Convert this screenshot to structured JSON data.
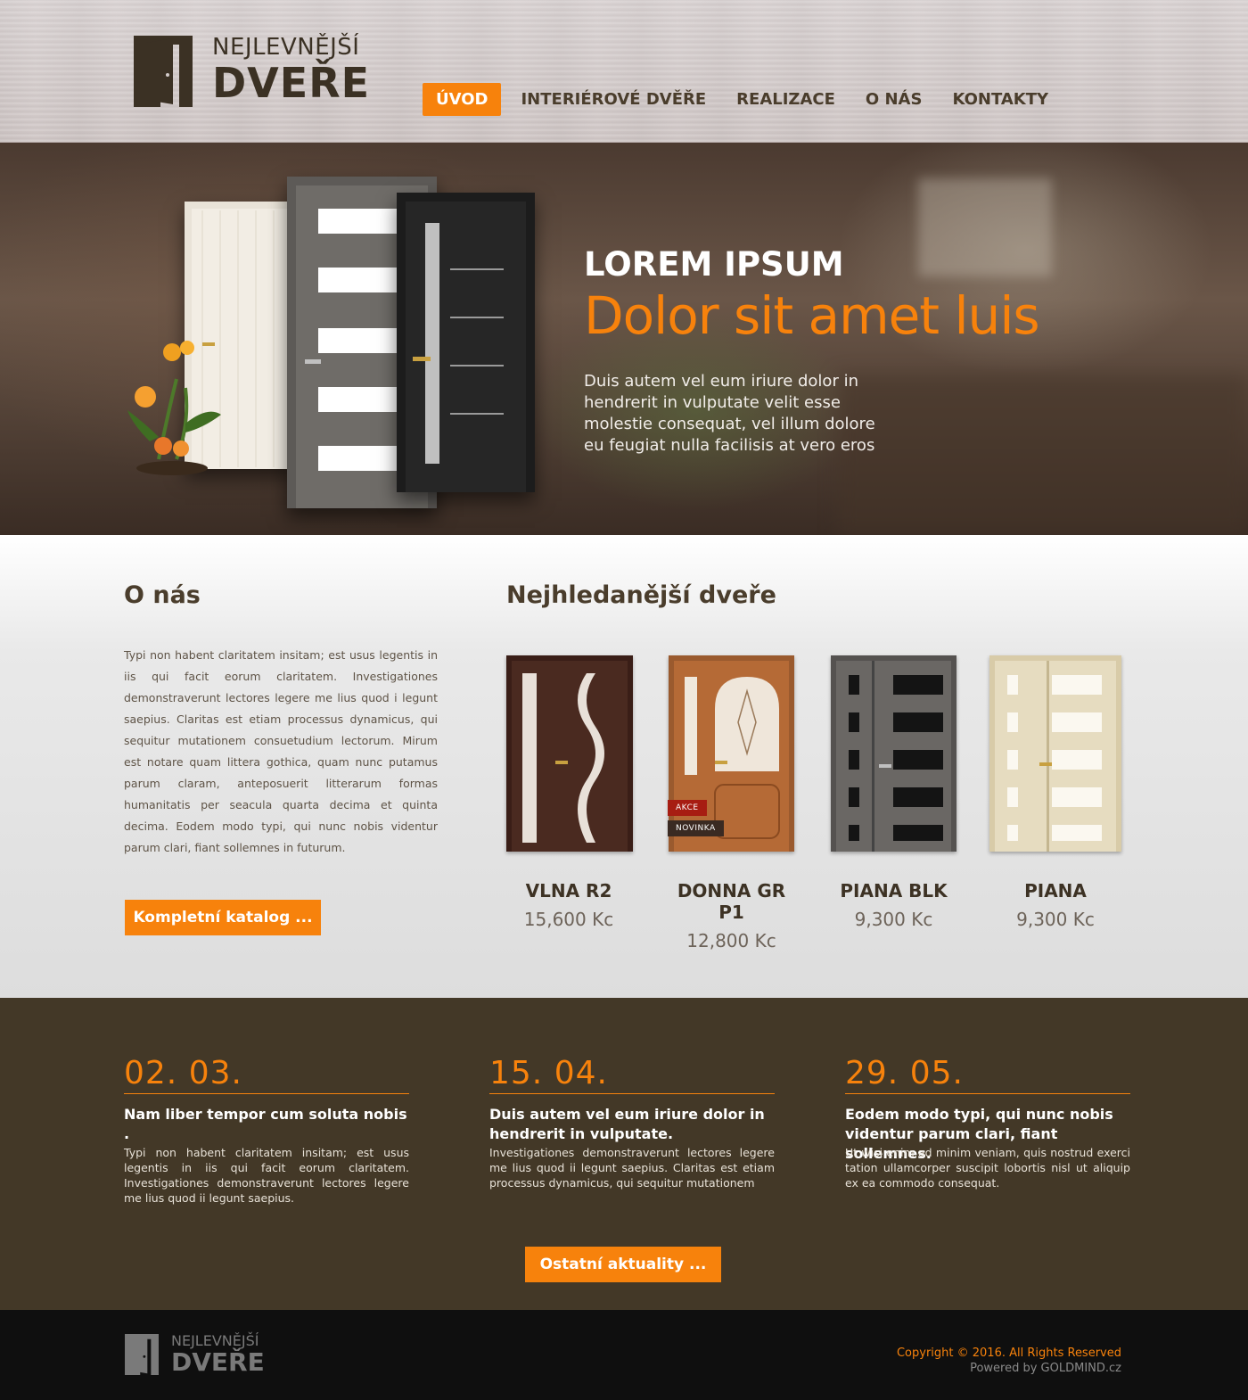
{
  "brand": {
    "top": "NEJLEVNĚJŠÍ",
    "bottom": "DVEŘE"
  },
  "nav": {
    "items": [
      "ÚVOD",
      "INTERIÉROVÉ DVĚŘE",
      "REALIZACE",
      "O NÁS",
      "KONTAKTY"
    ],
    "active": "ÚVOD"
  },
  "hero": {
    "title": "LOREM IPSUM",
    "subtitle": "Dolor sit amet luis",
    "description": "Duis autem vel eum iriure dolor in hendrerit in vulputate velit esse molestie consequat, vel illum dolore eu feugiat nulla facilisis at vero eros"
  },
  "about": {
    "heading": "O nás",
    "text": "Typi non habent claritatem insitam; est usus legentis in iis qui facit eorum claritatem. Investigationes demonstraverunt lectores legere me lius quod i legunt saepius. Claritas est etiam processus dynamicus, qui sequitur mutationem consuetudium lectorum. Mirum est notare quam littera gothica, quam nunc putamus parum claram, anteposuerit litterarum formas humanitatis per seacula quarta decima et quinta decima. Eodem modo typi, qui nunc nobis videntur parum clari, fiant sollemnes in futurum.",
    "button": "Kompletní katalog ..."
  },
  "products": {
    "heading": "Nejhledanější dveře",
    "items": [
      {
        "name": "VLNA R2",
        "price": "15,600 Kc"
      },
      {
        "name": "DONNA GR P1",
        "price": "12,800 Kc",
        "badges": [
          "AKCE",
          "NOVINKA"
        ]
      },
      {
        "name": "PIANA BLK",
        "price": "9,300 Kc"
      },
      {
        "name": "PIANA",
        "price": "9,300 Kc"
      }
    ]
  },
  "news": {
    "items": [
      {
        "date": "02. 03.",
        "title": "Nam liber tempor cum soluta nobis .",
        "text": "Typi non habent claritatem insitam; est usus legentis in iis qui facit eorum claritatem. Investigationes demonstraverunt lectores legere me lius quod ii legunt saepius."
      },
      {
        "date": "15. 04.",
        "title": "Duis autem vel eum iriure dolor in hendrerit in vulputate.",
        "text": "Investigationes demonstraverunt lectores legere me lius quod ii legunt saepius. Claritas est etiam processus dynamicus, qui sequitur mutationem"
      },
      {
        "date": "29. 05.",
        "title": "Eodem modo typi, qui nunc nobis videntur parum clari, fiant sollemnes.",
        "text": "Ut wisi enim ad minim veniam, quis nostrud exerci tation ullamcorper suscipit lobortis nisl ut aliquip ex ea commodo consequat."
      }
    ],
    "button": "Ostatní aktuality ..."
  },
  "footer": {
    "copyright": "Copyright © 2016. All Rights Reserved",
    "powered": "Powered by GOLDMIND.cz"
  },
  "colors": {
    "accent": "#f7820c",
    "brown": "#433827",
    "text": "#4a3d2c"
  }
}
